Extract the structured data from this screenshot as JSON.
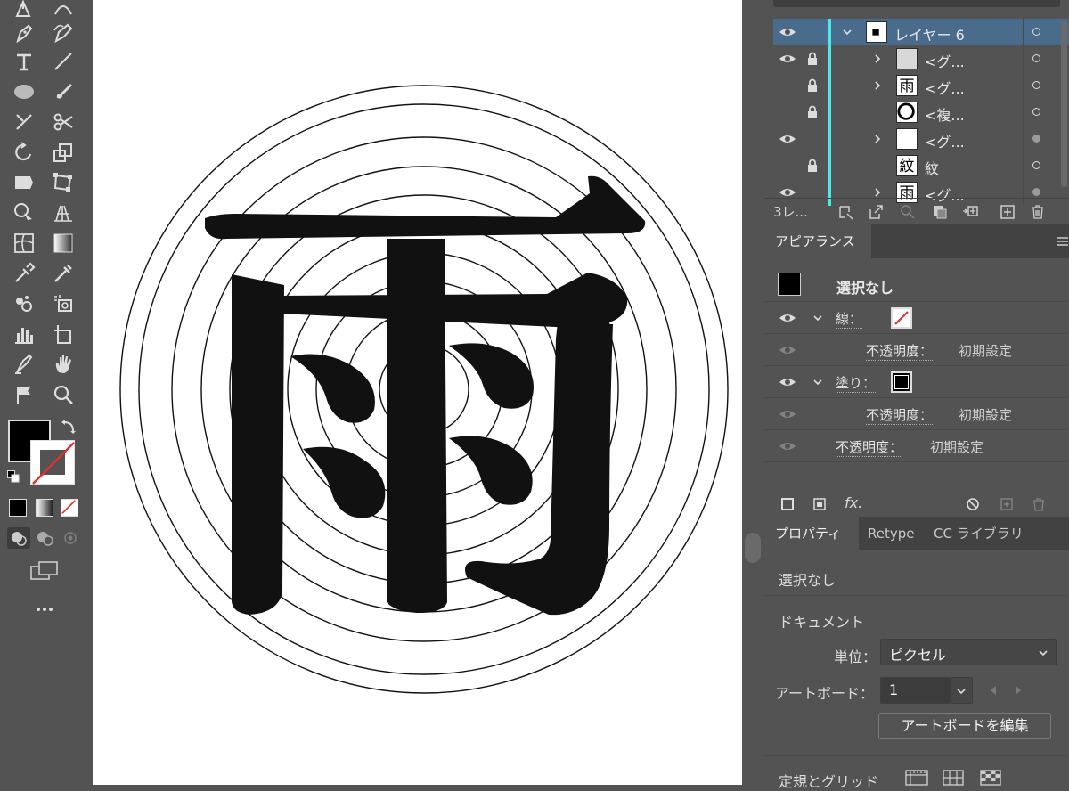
{
  "colors": {
    "panel": "#535353",
    "selected_row": "#4a6c8c",
    "layer_color": "#4de8e8",
    "canvas": "#ffffff"
  },
  "tools": [
    "pen-tool",
    "curvature-tool",
    "type-tool",
    "line-tool",
    "ellipse-tool",
    "paintbrush-tool",
    "eraser-tool",
    "scissors-tool",
    "rotate-tool",
    "scale-tool",
    "width-tool",
    "free-transform-tool",
    "shape-builder-tool",
    "perspective-grid-tool",
    "mesh-tool",
    "gradient-tool",
    "eyedropper-tool",
    "measure-tool",
    "symbol-sprayer-tool",
    "symbol-tool",
    "column-graph-tool",
    "artboard-tool",
    "slice-tool",
    "hand-tool",
    "warp-tool",
    "zoom-tool"
  ],
  "layers": {
    "rows": [
      {
        "name": "レイヤー 6",
        "thumb": "▦",
        "eye": true,
        "lock": false,
        "expanded": true,
        "target_filled": false
      },
      {
        "name": "<グ...",
        "thumb": "",
        "eye": true,
        "lock": true,
        "expanded": false,
        "target_filled": false
      },
      {
        "name": "<グ...",
        "thumb": "雨",
        "eye": false,
        "lock": true,
        "expanded": false,
        "target_filled": false
      },
      {
        "name": "<複...",
        "thumb": "○",
        "eye": false,
        "lock": true,
        "expanded": false,
        "target_filled": false
      },
      {
        "name": "<グ...",
        "thumb": "",
        "eye": true,
        "lock": false,
        "expanded": false,
        "target_filled": true
      },
      {
        "name": "紋",
        "thumb": "紋",
        "eye": false,
        "lock": true,
        "expanded": false,
        "target_filled": false
      },
      {
        "name": "<グ...",
        "thumb": "雨",
        "eye": true,
        "lock": false,
        "expanded": false,
        "target_filled": true
      }
    ],
    "count_label": "3レ..."
  },
  "appearance": {
    "tab_label": "アピアランス",
    "selection_label": "選択なし",
    "stroke_label": "線：",
    "fill_label": "塗り：",
    "opacity_label": "不透明度：",
    "opacity_value": "初期設定",
    "fx_label": "fx."
  },
  "properties": {
    "tabs": [
      "プロパティ",
      "Retype",
      "CC ライブラリ"
    ],
    "selection_label": "選択なし",
    "document_heading": "ドキュメント",
    "unit_label": "単位：",
    "unit_value": "ピクセル",
    "artboard_label": "アートボード：",
    "artboard_value": "1",
    "edit_artboard_button": "アートボードを編集",
    "rulers_grids_heading": "定規とグリッド"
  },
  "artwork": {
    "glyph": "雨",
    "ring_count": 10
  }
}
